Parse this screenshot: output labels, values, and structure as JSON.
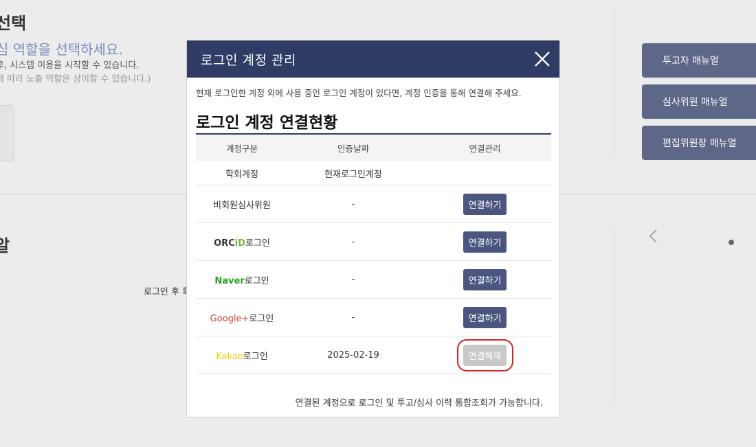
{
  "background": {
    "title": "선택",
    "subtitle": "심 역할을 선택하세요.",
    "line1": "후, 시스템 이용을 시작할 수 있습니다.",
    "line2": "에 따라 노출 역할은 상이할 수 있습니다.)",
    "section_title": "알",
    "login_hint": "로그인 후 확",
    "manuals": [
      "투고자 매뉴얼",
      "심사위원 매뉴얼",
      "편집위원장 매뉴얼"
    ]
  },
  "modal": {
    "title": "로그인 계정 관리",
    "description": "현재 로그인한 계정 외에 사용 중인 로그인 계정이 있다면, 계정 인증을 통해 연결해 주세요.",
    "section_title": "로그인 계정 연결현황",
    "columns": [
      "계정구분",
      "인증날짜",
      "연결관리"
    ],
    "rows": [
      {
        "account_prefix": "",
        "account_label": "학회계정",
        "date": "현재로그인계정",
        "action": ""
      },
      {
        "account_prefix": "",
        "account_label": "비회원심사위원",
        "date": "-",
        "action": "연결하기"
      },
      {
        "account_prefix": "ORC",
        "account_prefix2": "iD",
        "account_label": "로그인",
        "date": "-",
        "action": "연결하기"
      },
      {
        "account_prefix": "Naver",
        "account_label": "로그인",
        "date": "-",
        "action": "연결하기"
      },
      {
        "account_prefix": "Google+",
        "account_label": "로그인",
        "date": "-",
        "action": "연결하기"
      },
      {
        "account_prefix": "Kakao",
        "account_label": "로그인",
        "date": "2025-02-19",
        "action": "연결해제"
      }
    ],
    "footer_note": "연결된 계정으로 로그인 및 투고/심사 이력 통합조회가 가능합니다."
  },
  "colors": {
    "header_bg": "#2e3c66",
    "connect_button": "#4a5680",
    "disconnect_button": "#c8c8c8",
    "highlight_ring": "#d62222",
    "manual_button": "#5e6788",
    "naver": "#2aa11d",
    "google": "#d23f31",
    "kakao": "#f2d100",
    "orcid_id": "#7cb342"
  },
  "icons": {
    "close": "close-icon",
    "carousel_prev": "chevron-left-icon"
  }
}
